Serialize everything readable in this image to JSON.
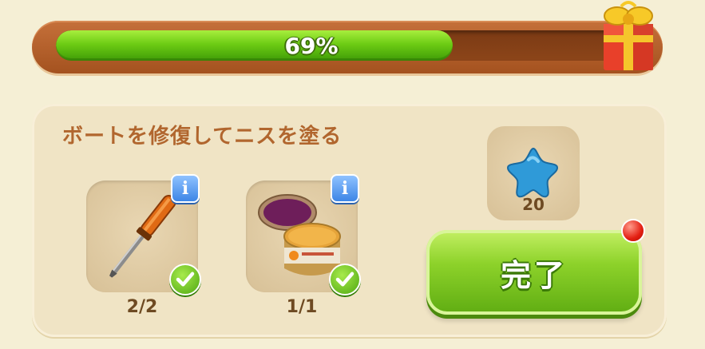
{
  "progress": {
    "percent_label": "69%",
    "fraction": 0.69
  },
  "task": {
    "title": "ボートを修復してニスを塗る",
    "items": [
      {
        "icon": "screwdriver-icon",
        "count": "2/2",
        "done": true
      },
      {
        "icon": "varnish-jar-icon",
        "count": "1/1",
        "done": true
      }
    ],
    "reward": {
      "icon": "blue-star-icon",
      "value": "20"
    },
    "complete_label": "完了"
  },
  "colors": {
    "progress_green": "#6dcc14",
    "frame_brown": "#b35f2a",
    "title_brown": "#b1662e",
    "button_green": "#8dd22a",
    "info_blue": "#3d86e6",
    "notify_red": "#e31f12"
  }
}
